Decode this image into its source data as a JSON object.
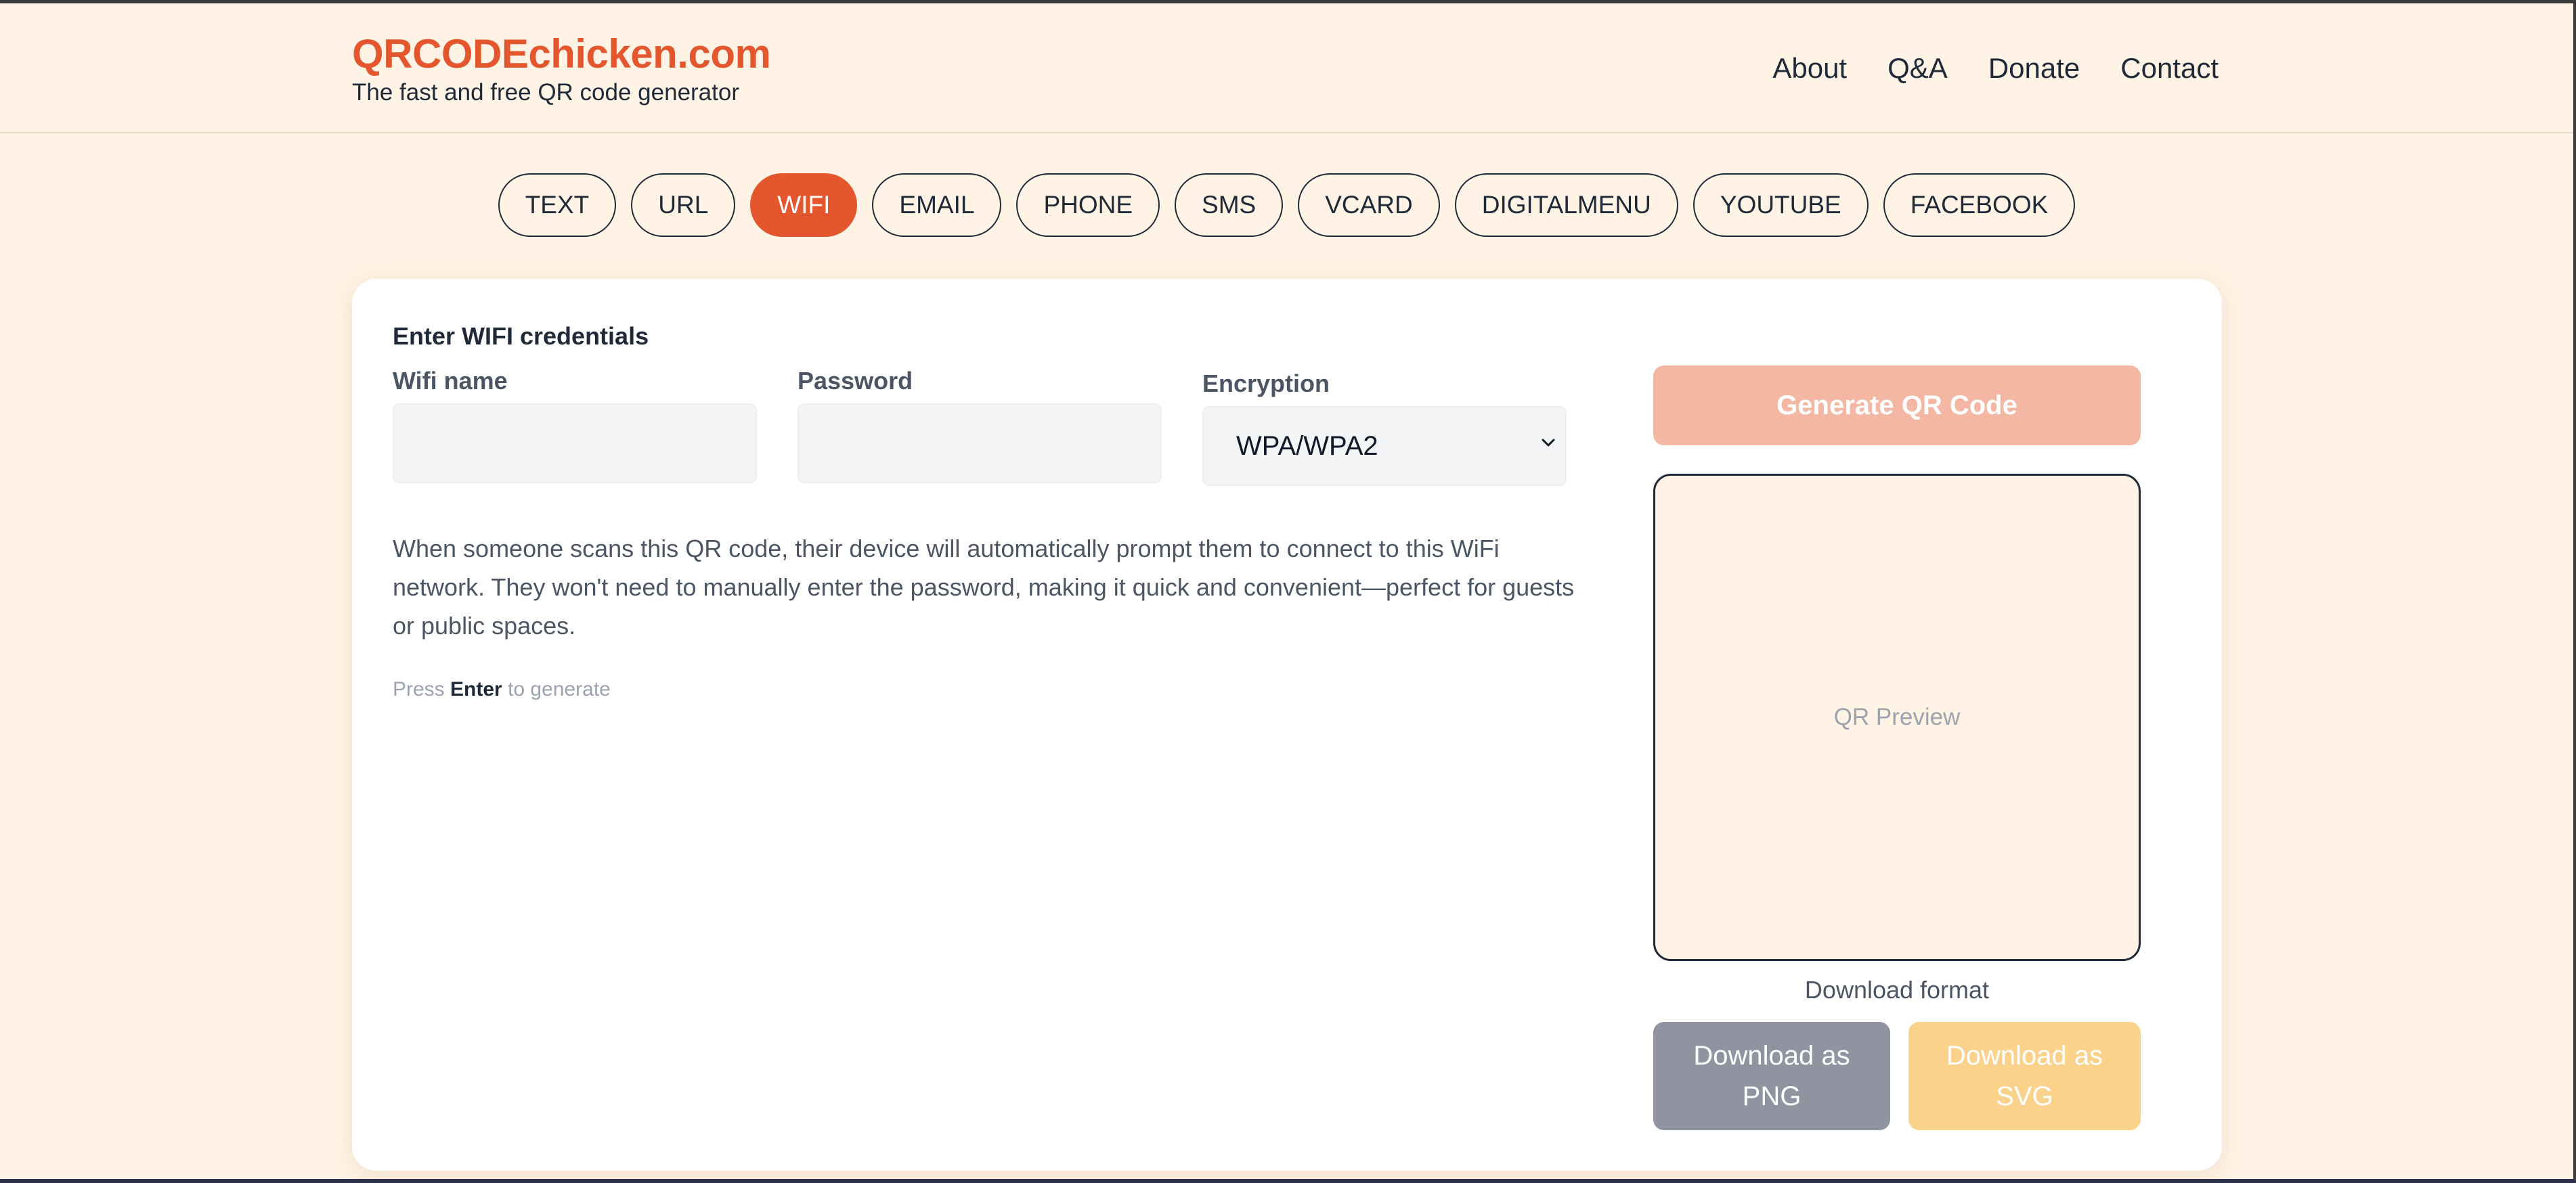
{
  "header": {
    "brand": "QRCODEchicken.com",
    "tagline": "The fast and free QR code generator",
    "nav": [
      "About",
      "Q&A",
      "Donate",
      "Contact"
    ]
  },
  "tabs": [
    "TEXT",
    "URL",
    "WIFI",
    "EMAIL",
    "PHONE",
    "SMS",
    "VCARD",
    "DIGITALMENU",
    "YOUTUBE",
    "FACEBOOK"
  ],
  "active_tab": "WIFI",
  "form": {
    "title": "Enter WIFI credentials",
    "wifi_name_label": "Wifi name",
    "wifi_name_value": "",
    "password_label": "Password",
    "password_value": "",
    "encryption_label": "Encryption",
    "encryption_value": "WPA/WPA2",
    "description": "When someone scans this QR code, their device will automatically prompt them to connect to this WiFi network. They won't need to manually enter the password, making it quick and convenient—perfect for guests or public spaces.",
    "hint_prefix": "Press",
    "hint_key": "Enter",
    "hint_suffix": "to generate"
  },
  "panel": {
    "generate_label": "Generate QR Code",
    "preview_label": "QR Preview",
    "download_format_label": "Download format",
    "download_png_label": "Download as PNG",
    "download_svg_label": "Download as SVG"
  },
  "colors": {
    "accent": "#e4572e",
    "background": "#fff3e5",
    "generate_disabled": "#f3b7a4",
    "png_button": "#9094a0",
    "svg_button": "#fad28b"
  }
}
